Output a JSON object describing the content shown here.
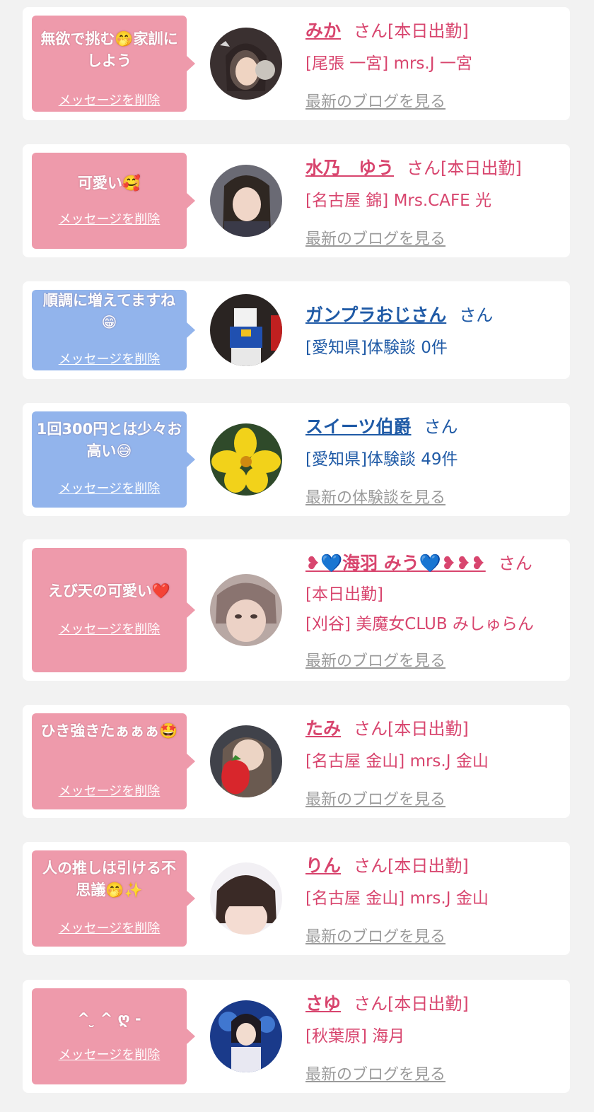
{
  "cards": [
    {
      "message": "無欲で挑む🤭家訓にしよう",
      "delete_label": "メッセージを削除",
      "name": "みか",
      "suffix": "さん[本日出勤]",
      "shop": "[尾張 一宮] mrs.J 一宮",
      "link": "最新のブログを見る"
    },
    {
      "message": "可愛い🥰",
      "delete_label": "メッセージを削除",
      "name": "水乃　ゆう",
      "suffix": "さん[本日出勤]",
      "shop": "[名古屋 錦] Mrs.CAFE 光",
      "link": "最新のブログを見る"
    },
    {
      "message": "順調に増えてますね😁",
      "delete_label": "メッセージを削除",
      "name": "ガンプラおじさん",
      "suffix": "さん",
      "shop": "[愛知県]体験談 0件"
    },
    {
      "message": "1回300円とは少々お高い😅",
      "delete_label": "メッセージを削除",
      "name": "スイーツ伯爵",
      "suffix": "さん",
      "shop": "[愛知県]体験談 49件",
      "link": "最新の体験談を見る"
    },
    {
      "message": "えび天の可愛い❤️",
      "delete_label": "メッセージを削除",
      "name": "❥💙海羽 みう💙❥❥❥",
      "suffix": "さん",
      "status": "[本日出勤]",
      "shop": "[刈谷] 美魔女CLUB みしゅらん",
      "link": "最新のブログを見る"
    },
    {
      "message": "ひき強きたぁぁぁ🤩",
      "delete_label": "メッセージを削除",
      "name": "たみ",
      "suffix": "さん[本日出勤]",
      "shop": "[名古屋 金山] mrs.J 金山",
      "link": "最新のブログを見る"
    },
    {
      "message": "人の推しは引ける不思議🤭✨",
      "delete_label": "メッセージを削除",
      "name": "りん",
      "suffix": "さん[本日出勤]",
      "shop": "[名古屋 金山] mrs.J 金山",
      "link": "最新のブログを見る"
    },
    {
      "message": "^ ̮ ^ ღ -",
      "delete_label": "メッセージを削除",
      "name": "さゆ",
      "suffix": "さん[本日出勤]",
      "shop": "[秋葉原] 海月",
      "link": "最新のブログを見る"
    }
  ]
}
